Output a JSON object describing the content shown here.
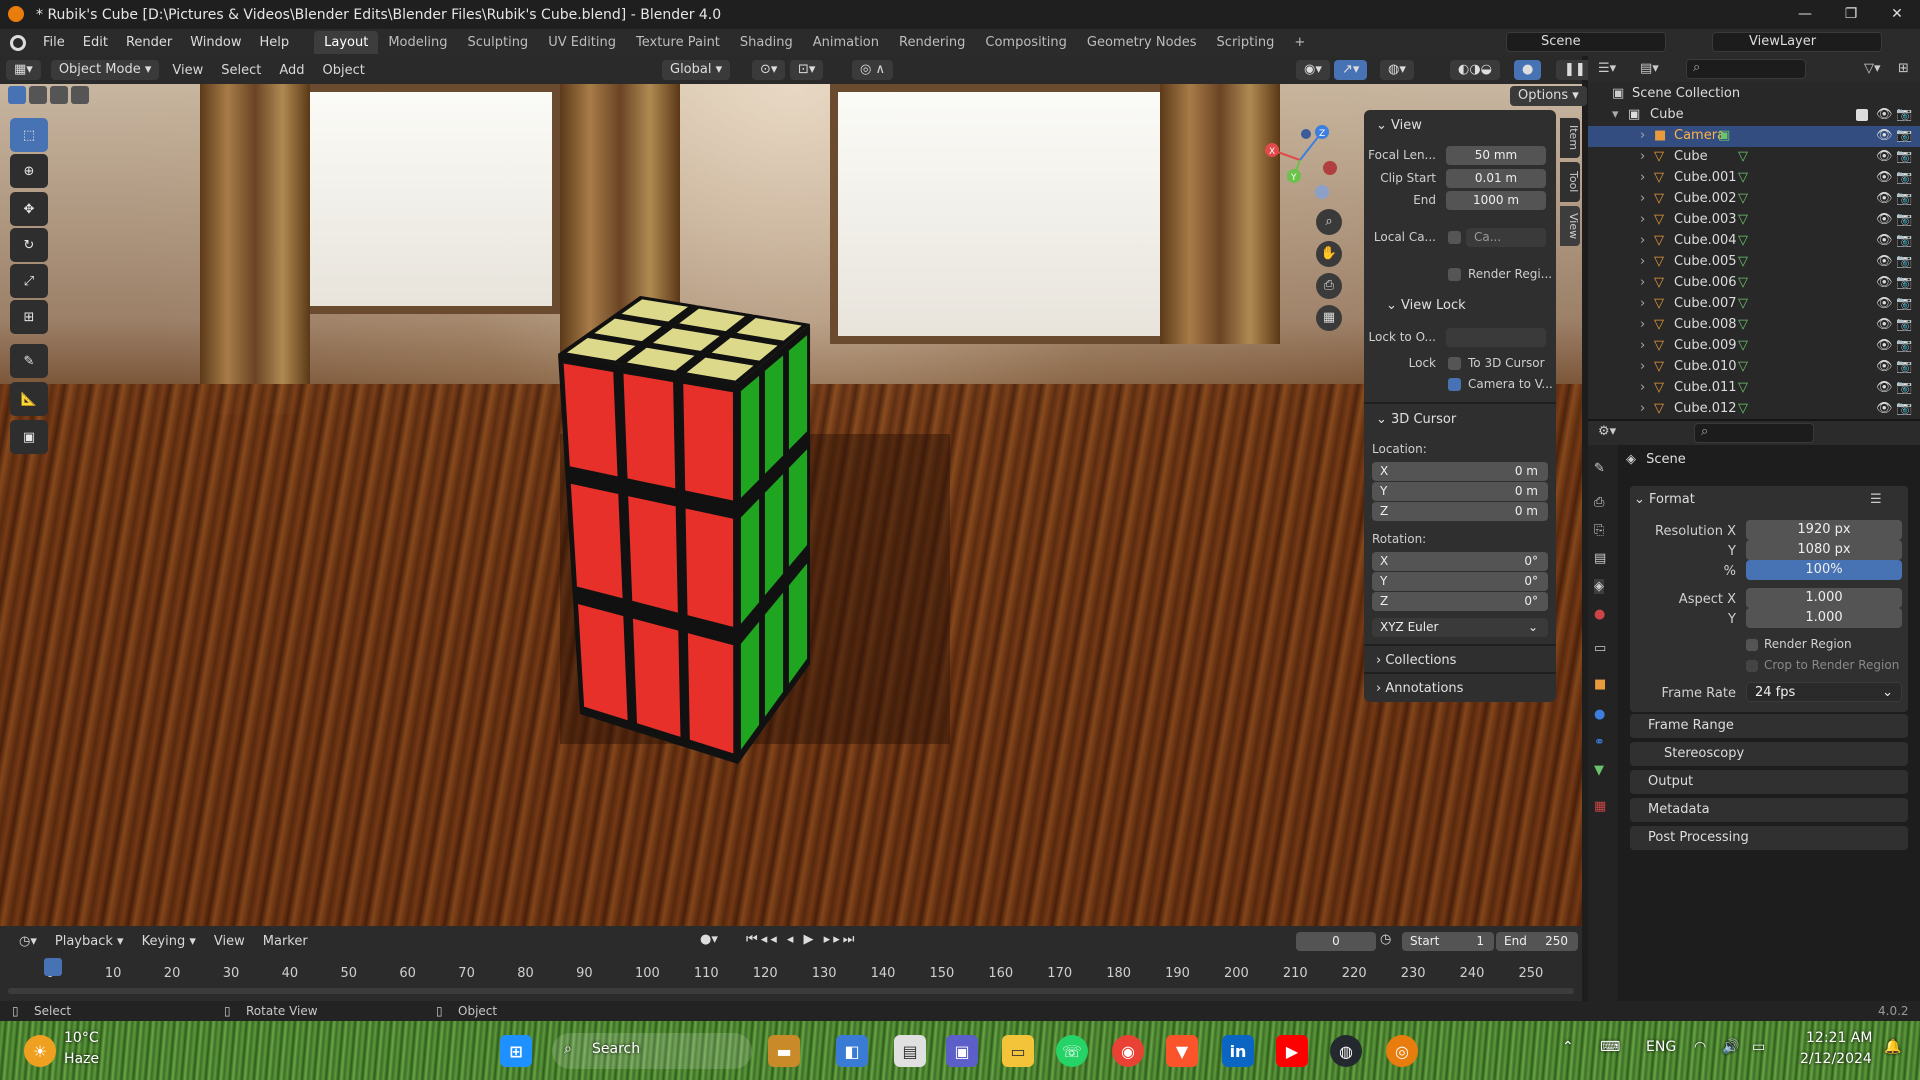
{
  "window": {
    "title": "* Rubik's Cube [D:\\Pictures & Videos\\Blender Edits\\Blender Files\\Rubik's Cube.blend] - Blender 4.0",
    "minimize_glyph": "—",
    "maximize_glyph": "❐",
    "close_glyph": "✕"
  },
  "menubar": {
    "menus": [
      "File",
      "Edit",
      "Render",
      "Window",
      "Help"
    ],
    "workspaces": [
      "Layout",
      "Modeling",
      "Sculpting",
      "UV Editing",
      "Texture Paint",
      "Shading",
      "Animation",
      "Rendering",
      "Compositing",
      "Geometry Nodes",
      "Scripting"
    ],
    "active_workspace": "Layout",
    "add_tab": "+",
    "scene": "Scene",
    "view_layer": "ViewLayer"
  },
  "viewport_header": {
    "mode": "Object Mode",
    "menus": [
      "View",
      "Select",
      "Add",
      "Object"
    ],
    "orientation": "Global",
    "options": "Options"
  },
  "npanel": {
    "view_title": "View",
    "focal_label": "Focal Len...",
    "focal_value": "50 mm",
    "clip_start_label": "Clip Start",
    "clip_start_value": "0.01 m",
    "end_label": "End",
    "end_value": "1000 m",
    "local_camera_label": "Local Ca...",
    "local_camera_value": "Ca...",
    "render_region_label": "Render Regi...",
    "view_lock_title": "View Lock",
    "lock_to_label": "Lock to O...",
    "lock_label": "Lock",
    "to_3d_cursor": "To 3D Cursor",
    "camera_to_view": "Camera to V...",
    "cursor_title": "3D Cursor",
    "location_label": "Location:",
    "loc_x": "0 m",
    "loc_y": "0 m",
    "loc_z": "0 m",
    "rotation_label": "Rotation:",
    "rot_x": "0°",
    "rot_y": "0°",
    "rot_z": "0°",
    "rotation_mode": "XYZ Euler",
    "collections": "Collections",
    "annotations": "Annotations",
    "axis_x": "X",
    "axis_y": "Y",
    "axis_z": "Z",
    "tabs": [
      "Item",
      "Tool",
      "View"
    ]
  },
  "outliner": {
    "root": "Scene Collection",
    "collection": "Cube",
    "items": [
      "Camera",
      "Cube",
      "Cube.001",
      "Cube.002",
      "Cube.003",
      "Cube.004",
      "Cube.005",
      "Cube.006",
      "Cube.007",
      "Cube.008",
      "Cube.009",
      "Cube.010",
      "Cube.011",
      "Cube.012"
    ],
    "selected": "Camera"
  },
  "properties": {
    "context": "Scene",
    "format_title": "Format",
    "res_x_label": "Resolution X",
    "res_x": "1920 px",
    "res_y_label": "Y",
    "res_y": "1080 px",
    "pct_label": "%",
    "pct": "100%",
    "aspect_x_label": "Aspect X",
    "aspect_x": "1.000",
    "aspect_y_label": "Y",
    "aspect_y": "1.000",
    "render_region": "Render Region",
    "crop": "Crop to Render Region",
    "frame_rate_label": "Frame Rate",
    "frame_rate": "24 fps",
    "sections": [
      "Frame Range",
      "Stereoscopy",
      "Output",
      "Metadata",
      "Post Processing"
    ]
  },
  "timeline": {
    "menus": [
      "Playback",
      "Keying",
      "View",
      "Marker"
    ],
    "current_frame": "0",
    "start_label": "Start",
    "start": "1",
    "end_label": "End",
    "end": "250",
    "ticks": [
      "0",
      "10",
      "20",
      "30",
      "40",
      "50",
      "60",
      "70",
      "80",
      "90",
      "100",
      "110",
      "120",
      "130",
      "140",
      "150",
      "160",
      "170",
      "180",
      "190",
      "200",
      "210",
      "220",
      "230",
      "240",
      "250"
    ]
  },
  "statusbar": {
    "select": "Select",
    "rotate": "Rotate View",
    "object": "Object",
    "version": "4.0.2"
  },
  "taskbar": {
    "temp": "10°C",
    "weather": "Haze",
    "search": "Search",
    "lang": "ENG",
    "time": "12:21 AM",
    "date": "2/12/2024"
  },
  "colors": {
    "accent": "#4772b3",
    "selection": "#334d80",
    "cube_red": "#e8302a",
    "cube_green": "#1fa51f",
    "cube_yellow": "#ddd98a"
  }
}
